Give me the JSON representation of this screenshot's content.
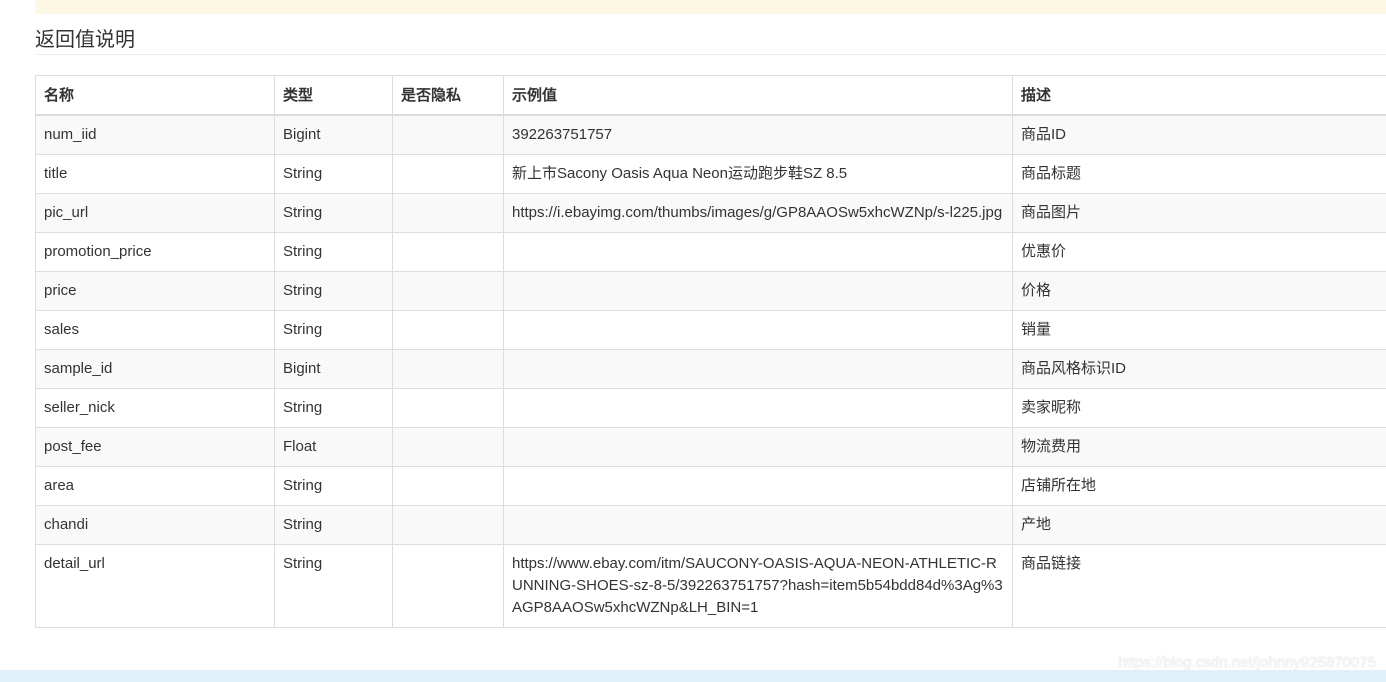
{
  "section": {
    "title": "返回值说明"
  },
  "table": {
    "headers": {
      "name": "名称",
      "type": "类型",
      "private": "是否隐私",
      "example": "示例值",
      "desc": "描述"
    },
    "rows": [
      {
        "name": "num_iid",
        "type": "Bigint",
        "private": "",
        "example": "392263751757",
        "desc": "商品ID"
      },
      {
        "name": "title",
        "type": "String",
        "private": "",
        "example": "新上市Sacony Oasis Aqua Neon运动跑步鞋SZ 8.5",
        "desc": "商品标题"
      },
      {
        "name": "pic_url",
        "type": "String",
        "private": "",
        "example": "https://i.ebayimg.com/thumbs/images/g/GP8AAOSw5xhcWZNp/s-l225.jpg",
        "desc": "商品图片"
      },
      {
        "name": "promotion_price",
        "type": "String",
        "private": "",
        "example": "",
        "desc": "优惠价"
      },
      {
        "name": "price",
        "type": "String",
        "private": "",
        "example": "",
        "desc": "价格"
      },
      {
        "name": "sales",
        "type": "String",
        "private": "",
        "example": "",
        "desc": "销量"
      },
      {
        "name": "sample_id",
        "type": "Bigint",
        "private": "",
        "example": "",
        "desc": "商品风格标识ID"
      },
      {
        "name": "seller_nick",
        "type": "String",
        "private": "",
        "example": "",
        "desc": "卖家昵称"
      },
      {
        "name": "post_fee",
        "type": "Float",
        "private": "",
        "example": "",
        "desc": "物流费用"
      },
      {
        "name": "area",
        "type": "String",
        "private": "",
        "example": "",
        "desc": "店铺所在地"
      },
      {
        "name": "chandi",
        "type": "String",
        "private": "",
        "example": "",
        "desc": "产地"
      },
      {
        "name": "detail_url",
        "type": "String",
        "private": "",
        "example": "https://www.ebay.com/itm/SAUCONY-OASIS-AQUA-NEON-ATHLETIC-RUNNING-SHOES-sz-8-5/392263751757?hash=item5b54bdd84d%3Ag%3AGP8AAOSw5xhcWZNp&LH_BIN=1",
        "desc": "商品链接"
      }
    ]
  },
  "watermark": "https://blog.csdn.net/johnny925870075",
  "colors": {
    "top_banner": "#fcf8e3",
    "stripe": "#f9f9f9",
    "border": "#dddddd",
    "bottom_bar": "#dff0f8"
  }
}
